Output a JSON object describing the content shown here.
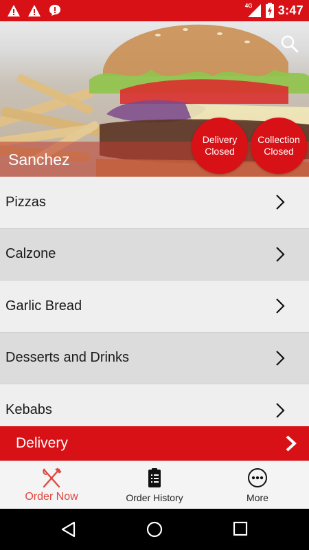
{
  "status_bar": {
    "time": "3:47",
    "network_label": "4G",
    "icons": [
      "warning-icon",
      "warning-icon",
      "chat-alert-icon",
      "signal-icon",
      "battery-charging-icon"
    ]
  },
  "header": {
    "restaurant_name": "Sanchez",
    "search_icon": "search-icon",
    "delivery_status": {
      "line1": "Delivery",
      "line2": "Closed"
    },
    "collection_status": {
      "line1": "Collection",
      "line2": "Closed"
    }
  },
  "categories": [
    {
      "label": "Pizzas"
    },
    {
      "label": "Calzone"
    },
    {
      "label": "Garlic Bread"
    },
    {
      "label": "Desserts and Drinks"
    },
    {
      "label": "Kebabs"
    }
  ],
  "delivery_bar": {
    "label": "Delivery"
  },
  "bottom_nav": {
    "items": [
      {
        "label": "Order Now",
        "icon": "fork-knife-icon",
        "active": true
      },
      {
        "label": "Order History",
        "icon": "clipboard-icon",
        "active": false
      },
      {
        "label": "More",
        "icon": "more-icon",
        "active": false
      }
    ]
  },
  "colors": {
    "brand": "#d81116",
    "active_nav": "#e0463e"
  }
}
